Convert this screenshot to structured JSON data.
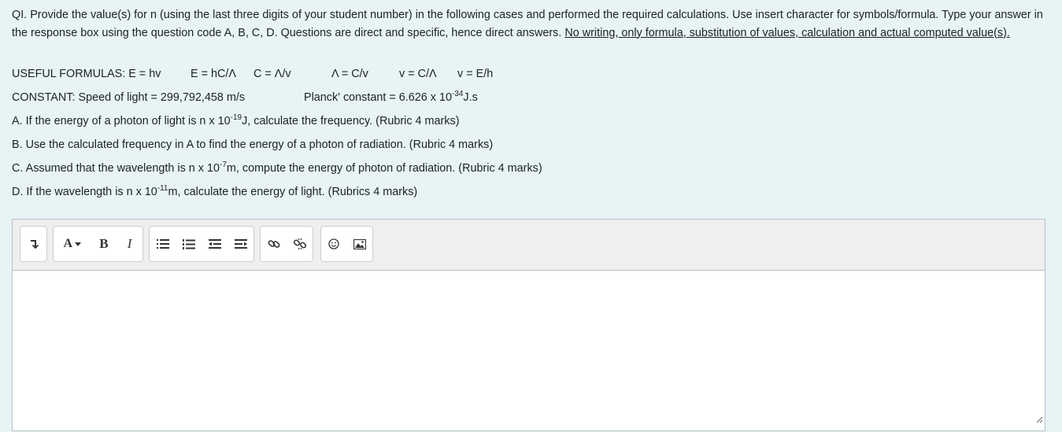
{
  "question": {
    "intro_text": "QI. Provide the value(s) for n (using the last three digits of your student number) in the following cases and performed the required calculations.  Use insert character for symbols/formula. Type your answer in the response box using the question code A, B, C, D. Questions are direct and specific, hence direct answers. ",
    "intro_underlined": "No writing, only formula, substitution of values, calculation and actual computed value(s).",
    "formulas_label": "USEFUL FORMULAS: E = hv",
    "formulas": [
      "E = hC/Λ",
      "C = Λ/v",
      "Λ = C/v",
      "v = C/Λ",
      "v = E/h"
    ],
    "constant_light": "CONSTANT: Speed of light = 299,792,458 m/s",
    "planck_prefix": "Planck' constant = 6.626 x 10",
    "planck_exp": "-34",
    "planck_suffix": "J.s",
    "a_prefix": "A. If the energy of a photon of light is n x 10",
    "a_exp": "-19",
    "a_suffix": "J, calculate the frequency. (Rubric 4 marks)",
    "b_text": "B. Use the calculated frequency in A to find the energy of a photon of radiation. (Rubric 4 marks)",
    "c_prefix": "C. Assumed that the wavelength is n x 10",
    "c_exp": "-7",
    "c_suffix": "m, compute the energy of photon of radiation. (Rubric 4 marks)",
    "d_prefix": "D. If the wavelength is n x 10",
    "d_exp": "-11",
    "d_suffix": "m, calculate the energy of light. (Rubrics 4 marks)"
  },
  "toolbar": {
    "toggle_icon": "collapse-toolbar-icon",
    "font_label": "A",
    "bold_label": "B",
    "italic_label": "I",
    "icons": [
      "unordered-list-icon",
      "ordered-list-icon",
      "outdent-icon",
      "indent-icon",
      "link-icon",
      "unlink-icon",
      "emoji-icon",
      "image-icon"
    ]
  },
  "editor": {
    "content": ""
  }
}
